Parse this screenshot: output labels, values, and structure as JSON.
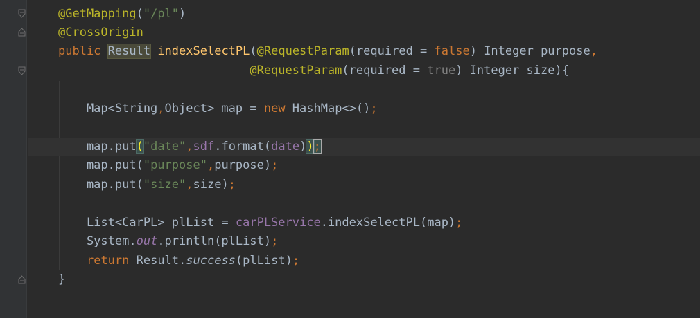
{
  "editor": {
    "lines": [
      {
        "segments": [
          {
            "t": "@GetMapping",
            "c": "ann"
          },
          {
            "t": "(",
            "c": ""
          },
          {
            "t": "\"/pl\"",
            "c": "str"
          },
          {
            "t": ")",
            "c": ""
          }
        ]
      },
      {
        "segments": [
          {
            "t": "@CrossOrigin",
            "c": "ann"
          }
        ]
      },
      {
        "segments": [
          {
            "t": "public ",
            "c": "kw"
          },
          {
            "t": "Result",
            "c": "type-hl"
          },
          {
            "t": " ",
            "c": ""
          },
          {
            "t": "indexSelectPL",
            "c": "fn"
          },
          {
            "t": "(",
            "c": ""
          },
          {
            "t": "@RequestParam",
            "c": "ann"
          },
          {
            "t": "(required = ",
            "c": ""
          },
          {
            "t": "false",
            "c": "kw"
          },
          {
            "t": ") Integer purpose",
            "c": ""
          },
          {
            "t": ",",
            "c": "kw"
          }
        ]
      },
      {
        "segments": [
          {
            "t": "                           ",
            "c": ""
          },
          {
            "t": "@RequestParam",
            "c": "ann"
          },
          {
            "t": "(required = ",
            "c": ""
          },
          {
            "t": "true",
            "c": "true-c"
          },
          {
            "t": ") Integer size){",
            "c": ""
          }
        ]
      },
      {
        "segments": []
      },
      {
        "segments": [
          {
            "t": "    Map<String",
            "c": ""
          },
          {
            "t": ",",
            "c": "kw"
          },
          {
            "t": "Object> map = ",
            "c": ""
          },
          {
            "t": "new ",
            "c": "kw"
          },
          {
            "t": "HashMap<>()",
            "c": ""
          },
          {
            "t": ";",
            "c": "kw"
          }
        ]
      },
      {
        "segments": []
      },
      {
        "segments": [
          {
            "t": "    map.put",
            "c": ""
          },
          {
            "t": "(",
            "c": "brace-hl"
          },
          {
            "t": "\"date\"",
            "c": "str"
          },
          {
            "t": ",",
            "c": "kw"
          },
          {
            "t": "sdf",
            "c": "fld"
          },
          {
            "t": ".format(",
            "c": ""
          },
          {
            "t": "date",
            "c": "fld"
          },
          {
            "t": ")",
            "c": ""
          },
          {
            "t": ")",
            "c": "brace-hl"
          },
          {
            "t": ";",
            "c": "cursor-semi"
          }
        ]
      },
      {
        "segments": [
          {
            "t": "    map.put(",
            "c": ""
          },
          {
            "t": "\"purpose\"",
            "c": "str"
          },
          {
            "t": ",",
            "c": "kw"
          },
          {
            "t": "purpose)",
            "c": ""
          },
          {
            "t": ";",
            "c": "kw"
          }
        ]
      },
      {
        "segments": [
          {
            "t": "    map.put(",
            "c": ""
          },
          {
            "t": "\"size\"",
            "c": "str"
          },
          {
            "t": ",",
            "c": "kw"
          },
          {
            "t": "size)",
            "c": ""
          },
          {
            "t": ";",
            "c": "kw"
          }
        ]
      },
      {
        "segments": []
      },
      {
        "segments": [
          {
            "t": "    List<CarPL> plList = ",
            "c": ""
          },
          {
            "t": "carPLService",
            "c": "fld"
          },
          {
            "t": ".indexSelectPL(map)",
            "c": ""
          },
          {
            "t": ";",
            "c": "kw"
          }
        ]
      },
      {
        "segments": [
          {
            "t": "    System.",
            "c": ""
          },
          {
            "t": "out",
            "c": "fld-it"
          },
          {
            "t": ".println(plList)",
            "c": ""
          },
          {
            "t": ";",
            "c": "kw"
          }
        ]
      },
      {
        "segments": [
          {
            "t": "    ",
            "c": ""
          },
          {
            "t": "return ",
            "c": "kw"
          },
          {
            "t": "Result.",
            "c": ""
          },
          {
            "t": "success",
            "c": "it"
          },
          {
            "t": "(plList)",
            "c": ""
          },
          {
            "t": ";",
            "c": "kw"
          }
        ]
      },
      {
        "segments": [
          {
            "t": "}",
            "c": ""
          }
        ]
      }
    ]
  },
  "icons": {
    "intention": "lightbulb-icon",
    "fold": "fold-marker-icon"
  },
  "colors": {
    "background": "#2b2b2b",
    "gutter": "#313335",
    "annotation": "#bbb529",
    "keyword": "#cc7832",
    "string": "#6a8759",
    "method": "#ffc66d",
    "field": "#9876aa",
    "default": "#a9b7c6"
  }
}
